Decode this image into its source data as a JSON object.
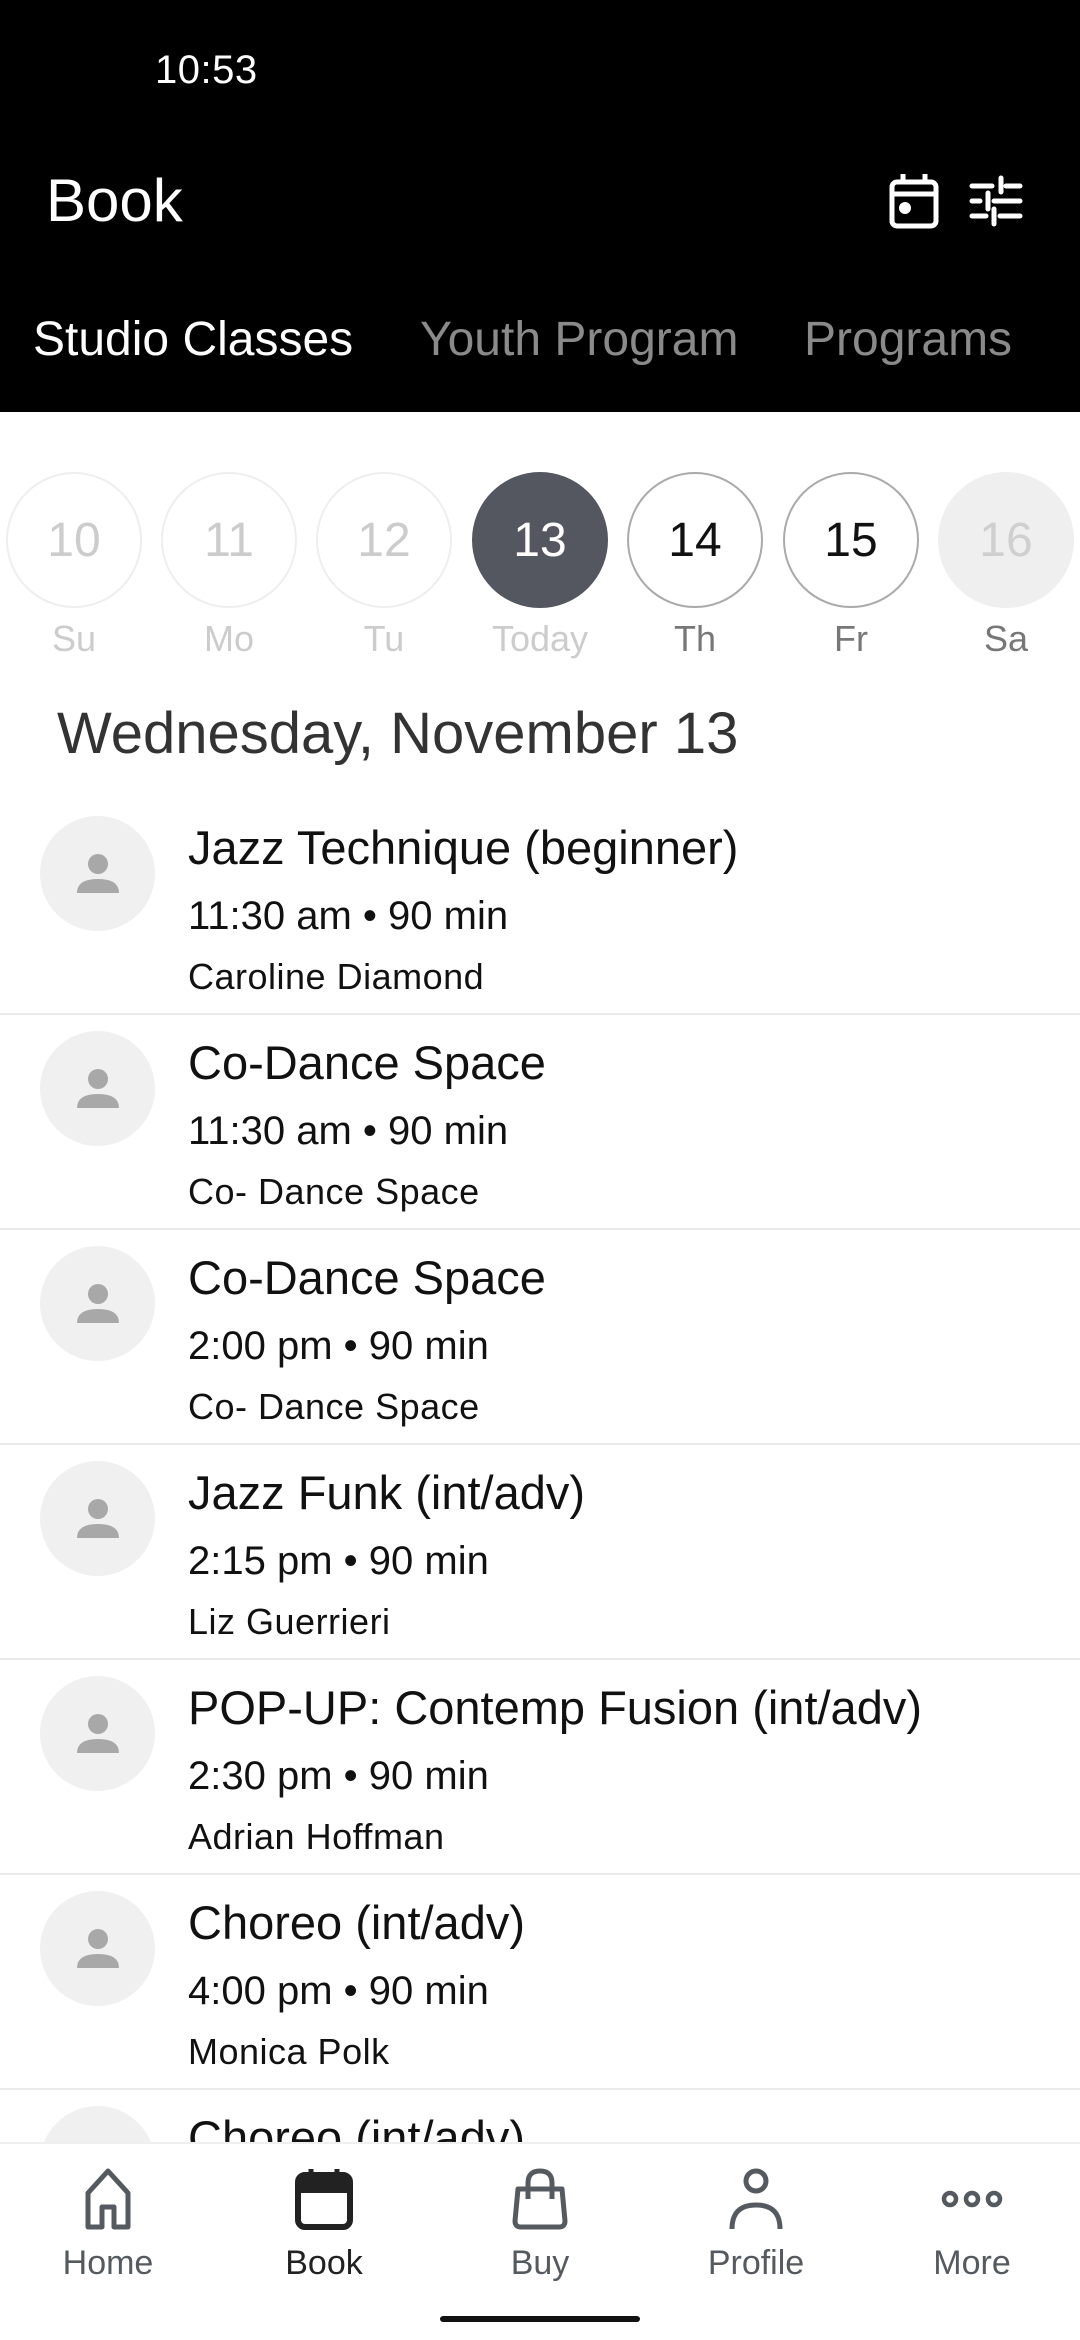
{
  "status_bar": {
    "time": "10:53"
  },
  "header": {
    "title": "Book",
    "icons": [
      "calendar-icon",
      "filter-sliders-icon"
    ]
  },
  "tabs": [
    {
      "label": "Studio Classes",
      "active": true
    },
    {
      "label": "Youth Program",
      "active": false
    },
    {
      "label": "Programs",
      "active": false
    }
  ],
  "date_strip": [
    {
      "date": "10",
      "label": "Su",
      "state": "past"
    },
    {
      "date": "11",
      "label": "Mo",
      "state": "past"
    },
    {
      "date": "12",
      "label": "Tu",
      "state": "past"
    },
    {
      "date": "13",
      "label": "Today",
      "state": "selected"
    },
    {
      "date": "14",
      "label": "Th",
      "state": "upcoming"
    },
    {
      "date": "15",
      "label": "Fr",
      "state": "upcoming"
    },
    {
      "date": "16",
      "label": "Sa",
      "state": "unavailable"
    }
  ],
  "selected_date_heading": "Wednesday, November 13",
  "classes": [
    {
      "name": "Jazz Technique (beginner)",
      "time": "11:30 am • 90 min",
      "instructor": "Caroline Diamond"
    },
    {
      "name": "Co-Dance Space",
      "time": "11:30 am • 90 min",
      "instructor": "Co- Dance Space"
    },
    {
      "name": "Co-Dance Space",
      "time": "2:00 pm • 90 min",
      "instructor": "Co- Dance Space"
    },
    {
      "name": "Jazz Funk (int/adv)",
      "time": "2:15 pm • 90 min",
      "instructor": "Liz Guerrieri"
    },
    {
      "name": "POP-UP: Contemp Fusion (int/adv)",
      "time": "2:30 pm • 90 min",
      "instructor": "Adrian Hoffman"
    },
    {
      "name": "Choreo (int/adv)",
      "time": "4:00 pm • 90 min",
      "instructor": "Monica Polk"
    },
    {
      "name": "Choreo (int/adv)",
      "time": "",
      "instructor": ""
    }
  ],
  "bottom_nav": [
    {
      "label": "Home",
      "icon": "home-icon",
      "active": false
    },
    {
      "label": "Book",
      "icon": "calendar-icon",
      "active": true
    },
    {
      "label": "Buy",
      "icon": "shopping-bag-icon",
      "active": false
    },
    {
      "label": "Profile",
      "icon": "person-icon",
      "active": false
    },
    {
      "label": "More",
      "icon": "more-dots-icon",
      "active": false
    }
  ],
  "colors": {
    "header_bg": "#000000",
    "selected_day": "#545760",
    "inactive_tab": "#8a8a8a",
    "avatar_bg": "#f0f0f0",
    "avatar_glyph": "#a8a8a8"
  }
}
